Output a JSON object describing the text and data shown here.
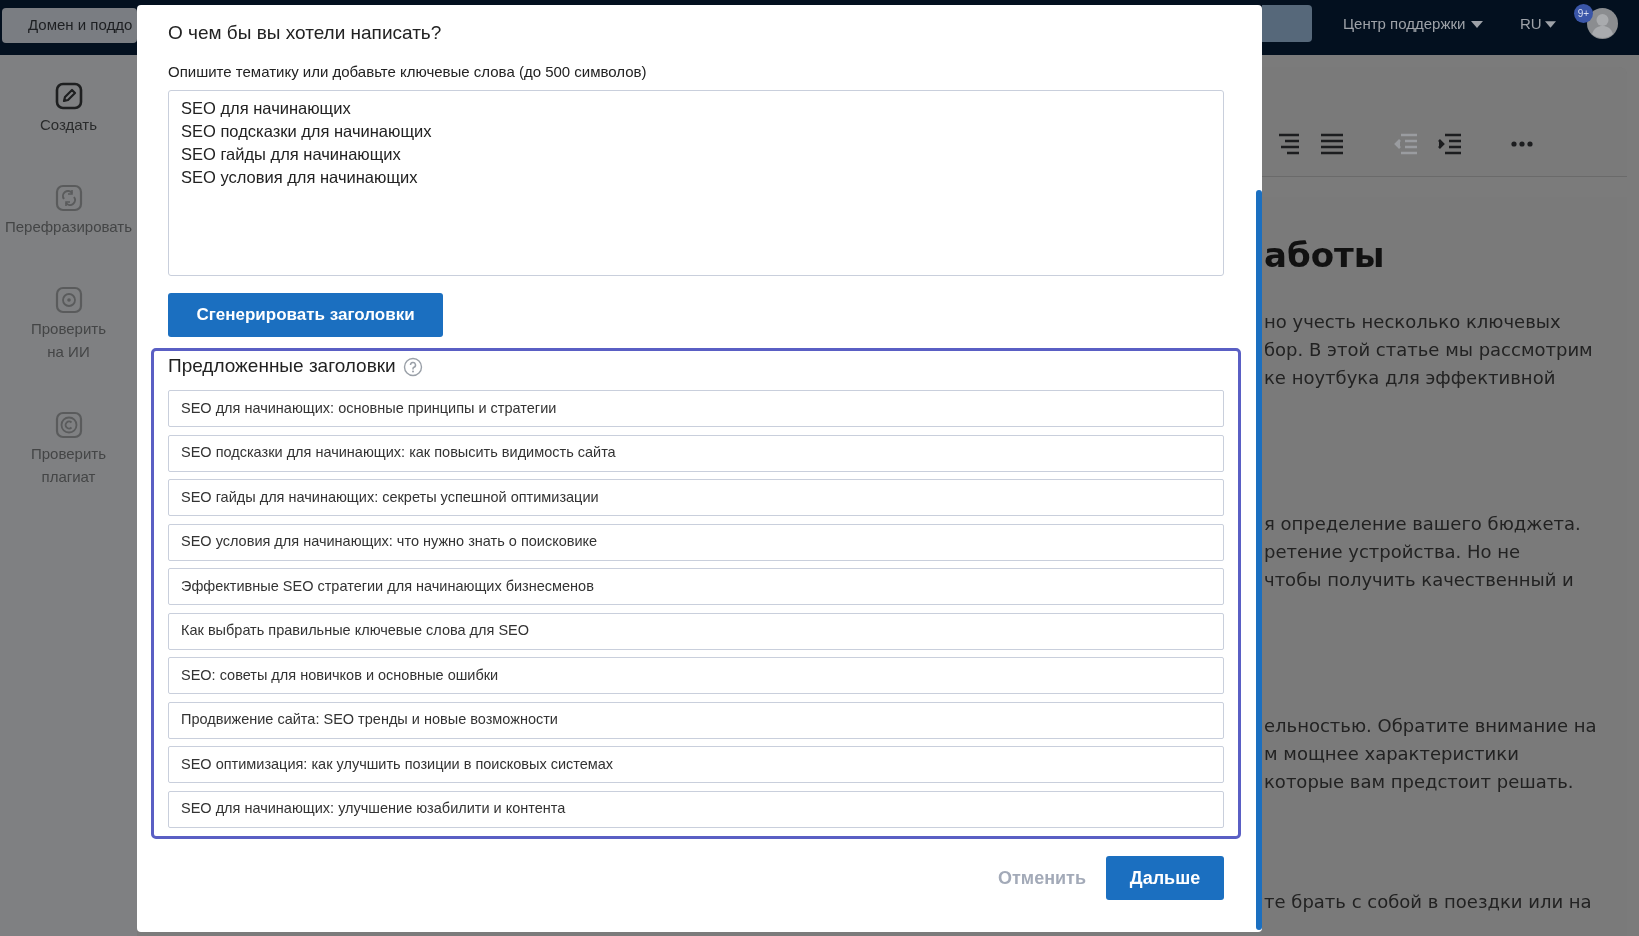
{
  "header": {
    "domain_button": "Домен и поддо",
    "support_menu": "Центр поддержки",
    "language_menu": "RU",
    "notification_count": "9+"
  },
  "sidebar": {
    "items": [
      {
        "label": "Создать",
        "kind": "pencil",
        "selected": true
      },
      {
        "label": "Перефразировать",
        "kind": "cycle",
        "selected": false
      },
      {
        "label": "Проверить на ИИ",
        "kind": "target",
        "selected": false
      },
      {
        "label": "Проверить плагиат",
        "kind": "copyright",
        "selected": false
      }
    ]
  },
  "editor": {
    "toolbar": [
      {
        "kind": "align-right",
        "disabled": false
      },
      {
        "kind": "justify",
        "disabled": false
      },
      {
        "kind": "outdent",
        "disabled": true
      },
      {
        "kind": "indent",
        "disabled": false
      },
      {
        "kind": "more",
        "disabled": false
      }
    ],
    "article": {
      "heading": "аботы",
      "paragraphs": [
        [
          "но учесть несколько ключевых",
          "бор. В этой статье мы рассмотрим",
          "ке ноутбука для эффективной"
        ],
        [
          "я определение вашего бюджета.",
          "ретение устройства. Но не",
          "чтобы получить качественный и"
        ],
        [
          "ельностью. Обратите внимание на",
          "м мощнее характеристики",
          "которые вам предстоит решать."
        ],
        [
          "те брать с собой в поездки или на"
        ]
      ]
    }
  },
  "dialog": {
    "title": "О чем бы вы хотели написать?",
    "prompt_label": "Опишите тематику или добавьте ключевые слова (до 500 символов)",
    "keywords": "SEO для начинающих\nSEO подсказки для начинающих\nSEO гайды для начинающих\nSEO условия для начинающих",
    "generate_button": "Сгенерировать заголовки",
    "suggestions": {
      "heading": "Предложенные заголовки",
      "items": [
        "SEO для начинающих: основные принципы и стратегии",
        "SEO подсказки для начинающих: как повысить видимость сайта",
        "SEO гайды для начинающих: секреты успешной оптимизации",
        "SEO условия для начинающих: что нужно знать о поисковике",
        "Эффективные SEO стратегии для начинающих бизнесменов",
        "Как выбрать правильные ключевые слова для SEO",
        "SEO: советы для новичков и основные ошибки",
        "Продвижение сайта: SEO тренды и новые возможности",
        "SEO оптимизация: как улучшить позиции в поисковых системах",
        "SEO для начинающих: улучшение юзабилити и контента"
      ]
    },
    "cancel_button": "Отменить",
    "next_button": "Дальше"
  }
}
